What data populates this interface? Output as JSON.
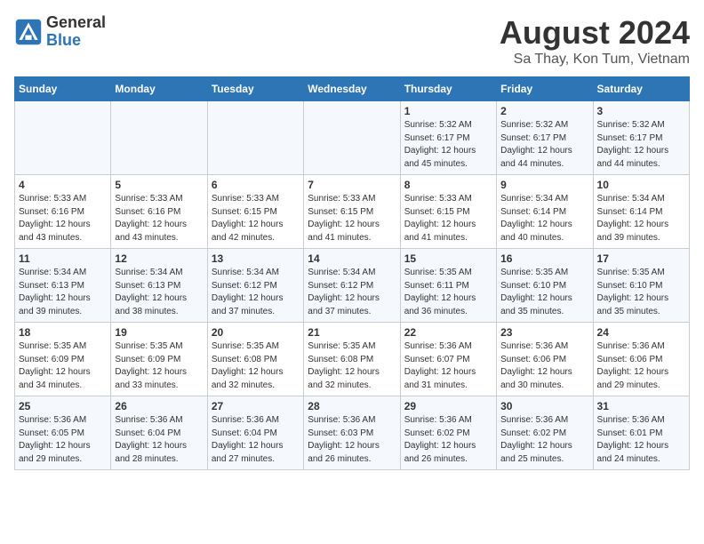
{
  "header": {
    "logo_line1": "General",
    "logo_line2": "Blue",
    "title": "August 2024",
    "subtitle": "Sa Thay, Kon Tum, Vietnam"
  },
  "weekdays": [
    "Sunday",
    "Monday",
    "Tuesday",
    "Wednesday",
    "Thursday",
    "Friday",
    "Saturday"
  ],
  "weeks": [
    [
      {
        "day": "",
        "info": ""
      },
      {
        "day": "",
        "info": ""
      },
      {
        "day": "",
        "info": ""
      },
      {
        "day": "",
        "info": ""
      },
      {
        "day": "1",
        "info": "Sunrise: 5:32 AM\nSunset: 6:17 PM\nDaylight: 12 hours\nand 45 minutes."
      },
      {
        "day": "2",
        "info": "Sunrise: 5:32 AM\nSunset: 6:17 PM\nDaylight: 12 hours\nand 44 minutes."
      },
      {
        "day": "3",
        "info": "Sunrise: 5:32 AM\nSunset: 6:17 PM\nDaylight: 12 hours\nand 44 minutes."
      }
    ],
    [
      {
        "day": "4",
        "info": "Sunrise: 5:33 AM\nSunset: 6:16 PM\nDaylight: 12 hours\nand 43 minutes."
      },
      {
        "day": "5",
        "info": "Sunrise: 5:33 AM\nSunset: 6:16 PM\nDaylight: 12 hours\nand 43 minutes."
      },
      {
        "day": "6",
        "info": "Sunrise: 5:33 AM\nSunset: 6:15 PM\nDaylight: 12 hours\nand 42 minutes."
      },
      {
        "day": "7",
        "info": "Sunrise: 5:33 AM\nSunset: 6:15 PM\nDaylight: 12 hours\nand 41 minutes."
      },
      {
        "day": "8",
        "info": "Sunrise: 5:33 AM\nSunset: 6:15 PM\nDaylight: 12 hours\nand 41 minutes."
      },
      {
        "day": "9",
        "info": "Sunrise: 5:34 AM\nSunset: 6:14 PM\nDaylight: 12 hours\nand 40 minutes."
      },
      {
        "day": "10",
        "info": "Sunrise: 5:34 AM\nSunset: 6:14 PM\nDaylight: 12 hours\nand 39 minutes."
      }
    ],
    [
      {
        "day": "11",
        "info": "Sunrise: 5:34 AM\nSunset: 6:13 PM\nDaylight: 12 hours\nand 39 minutes."
      },
      {
        "day": "12",
        "info": "Sunrise: 5:34 AM\nSunset: 6:13 PM\nDaylight: 12 hours\nand 38 minutes."
      },
      {
        "day": "13",
        "info": "Sunrise: 5:34 AM\nSunset: 6:12 PM\nDaylight: 12 hours\nand 37 minutes."
      },
      {
        "day": "14",
        "info": "Sunrise: 5:34 AM\nSunset: 6:12 PM\nDaylight: 12 hours\nand 37 minutes."
      },
      {
        "day": "15",
        "info": "Sunrise: 5:35 AM\nSunset: 6:11 PM\nDaylight: 12 hours\nand 36 minutes."
      },
      {
        "day": "16",
        "info": "Sunrise: 5:35 AM\nSunset: 6:10 PM\nDaylight: 12 hours\nand 35 minutes."
      },
      {
        "day": "17",
        "info": "Sunrise: 5:35 AM\nSunset: 6:10 PM\nDaylight: 12 hours\nand 35 minutes."
      }
    ],
    [
      {
        "day": "18",
        "info": "Sunrise: 5:35 AM\nSunset: 6:09 PM\nDaylight: 12 hours\nand 34 minutes."
      },
      {
        "day": "19",
        "info": "Sunrise: 5:35 AM\nSunset: 6:09 PM\nDaylight: 12 hours\nand 33 minutes."
      },
      {
        "day": "20",
        "info": "Sunrise: 5:35 AM\nSunset: 6:08 PM\nDaylight: 12 hours\nand 32 minutes."
      },
      {
        "day": "21",
        "info": "Sunrise: 5:35 AM\nSunset: 6:08 PM\nDaylight: 12 hours\nand 32 minutes."
      },
      {
        "day": "22",
        "info": "Sunrise: 5:36 AM\nSunset: 6:07 PM\nDaylight: 12 hours\nand 31 minutes."
      },
      {
        "day": "23",
        "info": "Sunrise: 5:36 AM\nSunset: 6:06 PM\nDaylight: 12 hours\nand 30 minutes."
      },
      {
        "day": "24",
        "info": "Sunrise: 5:36 AM\nSunset: 6:06 PM\nDaylight: 12 hours\nand 29 minutes."
      }
    ],
    [
      {
        "day": "25",
        "info": "Sunrise: 5:36 AM\nSunset: 6:05 PM\nDaylight: 12 hours\nand 29 minutes."
      },
      {
        "day": "26",
        "info": "Sunrise: 5:36 AM\nSunset: 6:04 PM\nDaylight: 12 hours\nand 28 minutes."
      },
      {
        "day": "27",
        "info": "Sunrise: 5:36 AM\nSunset: 6:04 PM\nDaylight: 12 hours\nand 27 minutes."
      },
      {
        "day": "28",
        "info": "Sunrise: 5:36 AM\nSunset: 6:03 PM\nDaylight: 12 hours\nand 26 minutes."
      },
      {
        "day": "29",
        "info": "Sunrise: 5:36 AM\nSunset: 6:02 PM\nDaylight: 12 hours\nand 26 minutes."
      },
      {
        "day": "30",
        "info": "Sunrise: 5:36 AM\nSunset: 6:02 PM\nDaylight: 12 hours\nand 25 minutes."
      },
      {
        "day": "31",
        "info": "Sunrise: 5:36 AM\nSunset: 6:01 PM\nDaylight: 12 hours\nand 24 minutes."
      }
    ]
  ]
}
